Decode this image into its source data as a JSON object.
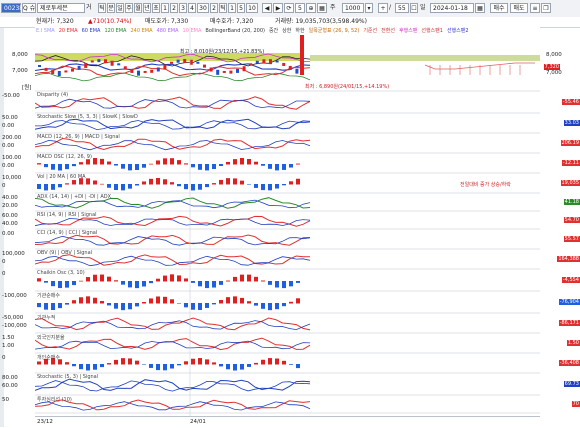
{
  "toolbar": {
    "code": "002380",
    "code_search": "Q 슈",
    "name": "제로투세븐",
    "name_suffix": "거",
    "period_buttons": [
      "틱",
      "분",
      "일",
      "주",
      "월",
      "년",
      "초",
      "1",
      "2",
      "3",
      "4",
      "30",
      "2",
      "틱",
      "1",
      "5",
      "10"
    ],
    "count": "1000",
    "count_prefix": "주",
    "count_sep": "/",
    "count2": "55",
    "date_label": "일",
    "date": "2024-01-18",
    "buy_label": "매수",
    "sell_label": "매도",
    "page_label": "5"
  },
  "info": {
    "current": "현재가: 7,320",
    "change": "▲710(10.74%)",
    "bid": "매도호가: 7,330",
    "ask": "매수호가: 7,320",
    "volume": "거래량: 19,035,703(3,598.49%)"
  },
  "legend": {
    "items": [
      {
        "text": "E.I 5MA",
        "color": "#9999ff"
      },
      {
        "text": "20 EMA",
        "color": "#e03030"
      },
      {
        "text": "60 EMA",
        "color": "#2040c0"
      },
      {
        "text": "120 EMA",
        "color": "#2a8a2a"
      },
      {
        "text": "240 EMA",
        "color": "#cc8800"
      },
      {
        "text": "480 EMA",
        "color": "#aa66ff"
      },
      {
        "text": "10 EMA",
        "color": "#ff88cc"
      },
      {
        "text": "BollingerBand (20, 200)",
        "color": "#333333"
      },
      {
        "text": "중간",
        "color": "#333333"
      },
      {
        "text": "상한",
        "color": "#333333"
      },
      {
        "text": "하한",
        "color": "#333333"
      },
      {
        "text": "일목균형표 (26, 9, 52)",
        "color": "#cc6600"
      },
      {
        "text": "기준선",
        "color": "#cc3333"
      },
      {
        "text": "전환선",
        "color": "#cc3333"
      },
      {
        "text": "후행스팬",
        "color": "#cc33cc"
      },
      {
        "text": "선행스팬1",
        "color": "#cc3333"
      },
      {
        "text": "선행스팬2",
        "color": "#3333cc"
      }
    ],
    "high_note": "최고 : 8,010원(23/12/15,+21.83%)",
    "low_note": "최저 : 6,890원(24/01/15,+14.19%)"
  },
  "price_axis": {
    "left_ticks": [
      "8,000",
      "7,000",
      "[원]"
    ],
    "right_ticks": [
      "8,000",
      "7,000"
    ],
    "current_tag": "7,320",
    "current_color": "#e02020"
  },
  "panels": [
    {
      "name": "Disparity",
      "label": "Disparity (4)",
      "left": [
        "-50.00"
      ],
      "right": "-55.46",
      "color": "#e03030"
    },
    {
      "name": "Stochastic Slow",
      "label": "Stochastic Slow (5, 3, 3) | SlowK | SlowD",
      "left": [
        "50.00",
        "0.00"
      ],
      "right": "33.03",
      "color": "#2040c0"
    },
    {
      "name": "MACD",
      "label": "MACD (12, 26, 9) | MACD | Signal",
      "left": [
        "200.00",
        "0.00"
      ],
      "right": "206.19",
      "color": "#e03030"
    },
    {
      "name": "MACD OSC",
      "label": "MACD OSC (12, 26, 9)",
      "left": [
        "100.00",
        "0.00"
      ],
      "right": "-12.11",
      "color": "#e03030"
    },
    {
      "name": "Volume",
      "label": "Vol | 20 MA | 60 MA",
      "left": [
        "10,000",
        "0"
      ],
      "right": "19,035",
      "color": "#e03030",
      "extra": "전일대비 증가 상승/하락"
    },
    {
      "name": "ADX",
      "label": "ADX (14, 14) | +DI | -DI | ADX",
      "left": [
        "40.00",
        "20.00"
      ],
      "right": "41.18",
      "color": "#2a8a2a"
    },
    {
      "name": "RSI",
      "label": "RSI (14, 9) | RSI | Signal",
      "left": [
        "60.00",
        "40.00"
      ],
      "right": "54.70",
      "color": "#e03030"
    },
    {
      "name": "CCI",
      "label": "CCI (14, 9) | CCI | Signal",
      "left": [
        "0.00"
      ],
      "right": "55.57",
      "color": "#e03030"
    },
    {
      "name": "OBV",
      "label": "OBV (9) | OBV | Signal",
      "left": [
        "100,000",
        "0"
      ],
      "right": "164,388",
      "color": "#e03030"
    },
    {
      "name": "Chaikin Osc",
      "label": "Chaikin Osc (3, 10)",
      "left": [
        "0"
      ],
      "right": "-4,554",
      "color": "#e03030"
    },
    {
      "name": "Foreign Net",
      "label": "기관순매수",
      "left": [
        "-100,000"
      ],
      "right": "-76,904",
      "color": "#2060e0"
    },
    {
      "name": "Foreign Hold",
      "label": "기관누적",
      "left": [
        "-50,000",
        "-100,000"
      ],
      "right": "-86,171",
      "color": "#e03030"
    },
    {
      "name": "Foreign Ratio",
      "label": "외국인지분율",
      "left": [
        "1.50",
        "1.00"
      ],
      "right": "1.50",
      "color": "#e03030"
    },
    {
      "name": "Individual Net",
      "label": "개인순매수",
      "left": [
        "0"
      ],
      "right": "-36,408",
      "color": "#e03030"
    },
    {
      "name": "Stochastic2",
      "label": "Stochastic (5, 3) | Signal",
      "left": [
        "80.00",
        "60.00"
      ],
      "right": "69.73",
      "color": "#2040c0"
    },
    {
      "name": "Psychology",
      "label": "투자심리선 (10)",
      "left": [
        "50"
      ],
      "right": "70",
      "color": "#e03030"
    }
  ],
  "dates": [
    "23/12",
    "24/01"
  ],
  "units": [
    "[원]",
    "[%]"
  ]
}
